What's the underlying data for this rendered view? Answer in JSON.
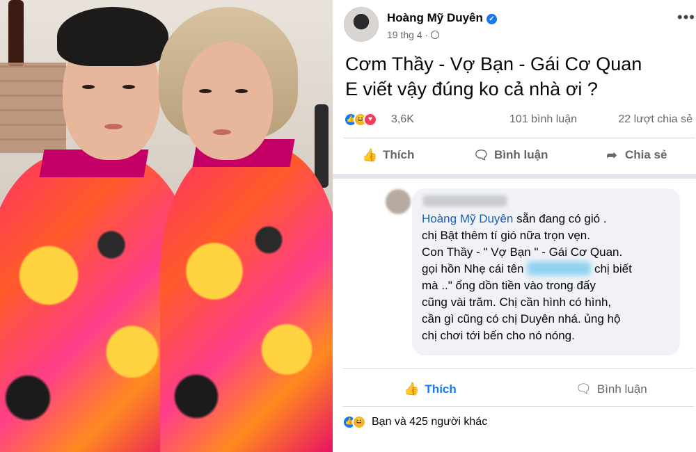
{
  "post": {
    "author": "Hoàng Mỹ Duyên",
    "date": "19 thg 4 ·",
    "text_line1": "Cơm Thầy - Vợ Bạn - Gái Cơ Quan",
    "text_line2": "E viết vậy đúng ko cả nhà ơi ?",
    "reaction_count": "3,6K",
    "comments_count": "101 bình luận",
    "shares_count": "22 lượt chia sẻ",
    "actions": {
      "like": "Thích",
      "comment": "Bình luận",
      "share": "Chia sẻ"
    }
  },
  "comment": {
    "mention": "Hoàng Mỹ Duyên",
    "line1_rest": " sẵn đang có gió .",
    "line2": "chị Bật thêm tí gió nữa trọn vẹn.",
    "line3": "Con Thầy - \" Vợ Bạn \" - Gái Cơ Quan.",
    "line4_a": "gọi hồn Nhẹ cái tên ",
    "line4_b": " chị biết",
    "line5": "mà ..\" ổng dồn tiền vào trong đấy",
    "line6": "cũng vài trăm. Chị cần hình có hình,",
    "line7": "cần gì cũng có chị Duyên nhá. ủng hộ",
    "line8": "chị chơi tới bến cho nó nóng.",
    "like_label": "Thích",
    "comment_label": "Bình luận",
    "reaction_summary": "Bạn và 425 người khác"
  },
  "colors": {
    "facebook_blue": "#1877f2",
    "text_gray": "#65676b",
    "bubble_bg": "#f0f2f5",
    "jacket_pink": "#ff2f6b"
  },
  "icons": [
    "verified-icon",
    "globe-icon",
    "more-icon",
    "like-icon",
    "comment-icon",
    "share-icon",
    "haha-icon",
    "love-icon"
  ]
}
